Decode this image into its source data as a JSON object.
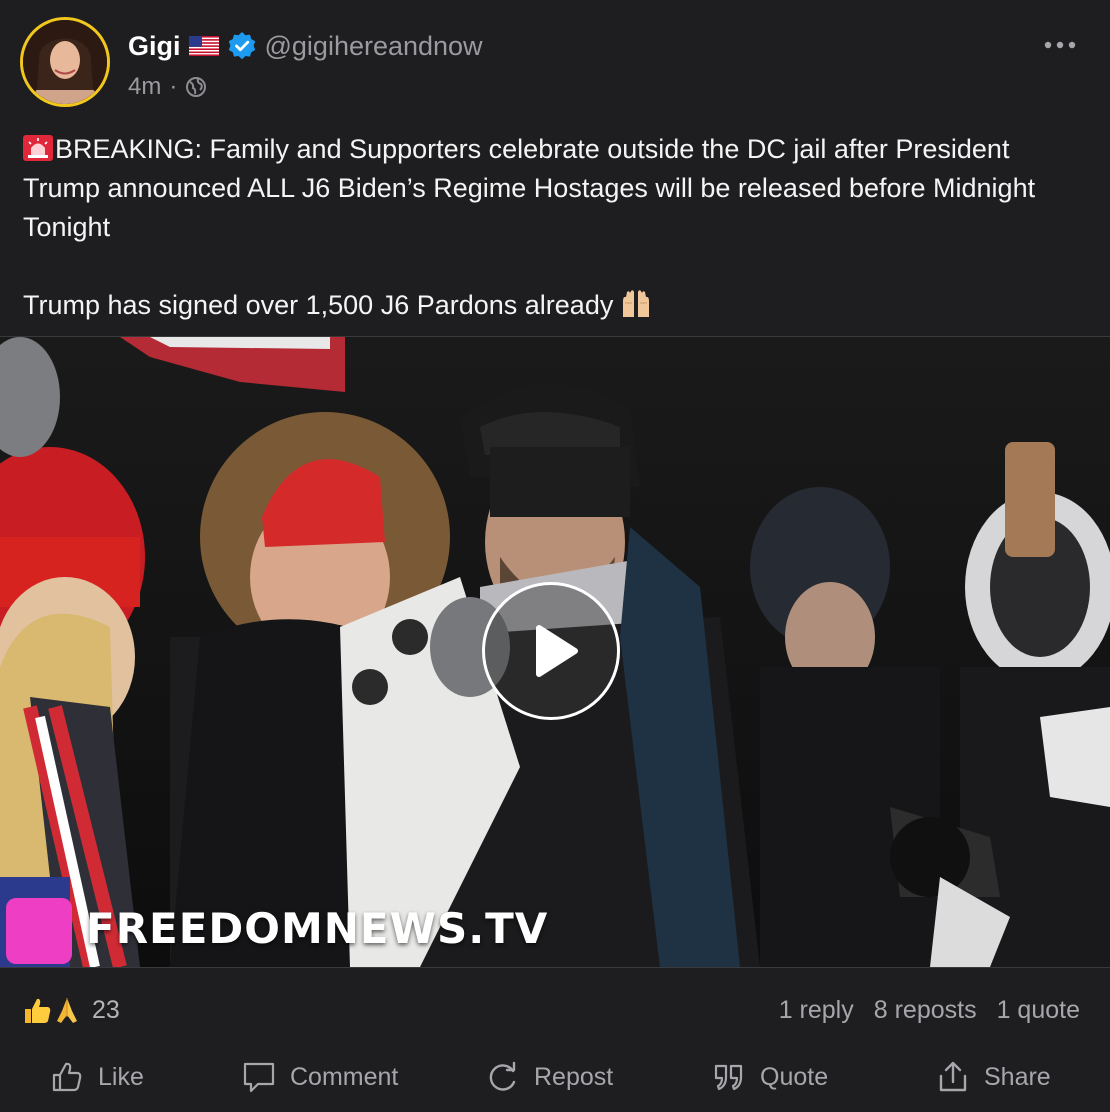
{
  "author": {
    "display_name": "Gigi",
    "handle": "@gigihereandnow",
    "verified": true,
    "flag": "us-flag-icon"
  },
  "meta": {
    "time": "4m",
    "separator": "·",
    "visibility_icon": "globe-icon"
  },
  "post": {
    "line1": "BREAKING: Family and Supporters celebrate outside the DC jail after President Trump announced ALL J6 Biden’s Regime Hostages will be released before Midnight Tonight",
    "line2": "Trump has signed over 1,500 J6 Pardons already",
    "leading_icon": "siren-icon",
    "trailing_icon": "raised-hands-icon"
  },
  "video": {
    "watermark": "FREEDOMNEWS.TV",
    "play_icon": "play-icon",
    "accent": "#ee3fc4"
  },
  "reactions": {
    "icons": [
      "thumbs-up-icon",
      "praying-hands-icon"
    ],
    "count": "23"
  },
  "stats": {
    "replies": "1 reply",
    "reposts": "8 reposts",
    "quotes": "1 quote"
  },
  "actions": {
    "like": "Like",
    "comment": "Comment",
    "repost": "Repost",
    "quote": "Quote",
    "share": "Share"
  },
  "colors": {
    "background": "#1e1e20",
    "verified": "#1d9bf0",
    "avatar_ring": "#f2c81d",
    "muted_text": "#9a9a9f"
  }
}
